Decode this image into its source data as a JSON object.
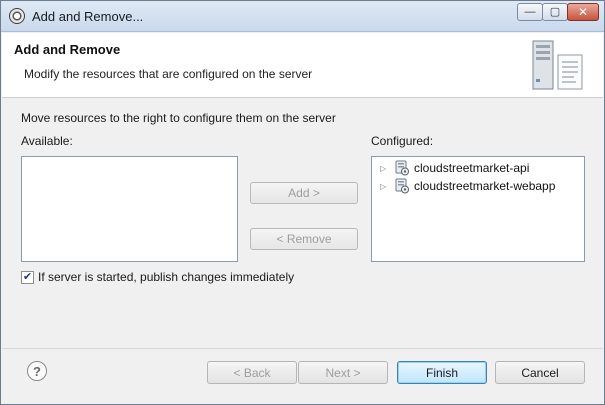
{
  "window": {
    "title": "Add and Remove...",
    "controls": {
      "minimize": "—",
      "maximize": "▢",
      "close": "✕"
    }
  },
  "header": {
    "title": "Add and Remove",
    "subtitle": "Modify the resources that are configured on the server"
  },
  "instructions": "Move resources to the right to configure them on the server",
  "available": {
    "label": "Available:",
    "items": []
  },
  "configured": {
    "label": "Configured:",
    "items": [
      {
        "label": "cloudstreetmarket-api",
        "icon": "web-project-icon"
      },
      {
        "label": "cloudstreetmarket-webapp",
        "icon": "web-project-icon"
      }
    ]
  },
  "buttons": {
    "add": "Add >",
    "remove": "< Remove",
    "back": "< Back",
    "next": "Next >",
    "finish": "Finish",
    "cancel": "Cancel"
  },
  "publish_option": {
    "label": "If server is started, publish changes immediately",
    "checked": true
  },
  "help": {
    "glyph": "?"
  },
  "colors": {
    "accent": "#3c7fb1",
    "disabled_text": "#9d9d9d"
  }
}
